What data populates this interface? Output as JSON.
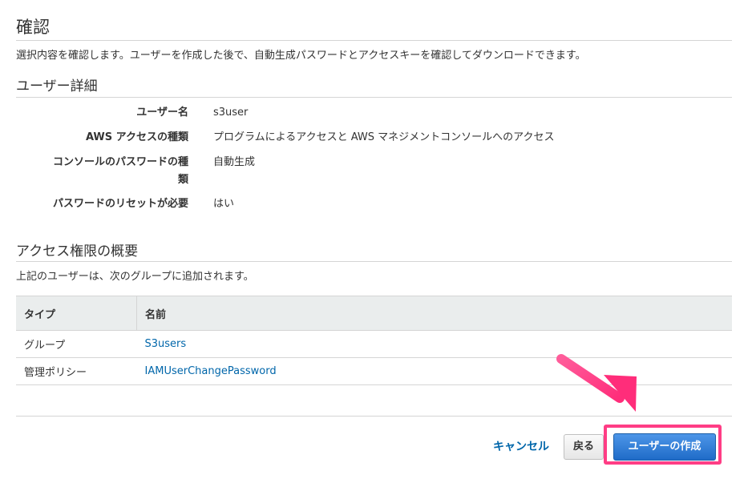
{
  "header": {
    "title": "確認",
    "description": "選択内容を確認します。ユーザーを作成した後で、自動生成パスワードとアクセスキーを確認してダウンロードできます。"
  },
  "user_details": {
    "heading": "ユーザー詳細",
    "rows": [
      {
        "label": "ユーザー名",
        "value": "s3user"
      },
      {
        "label": "AWS アクセスの種類",
        "value": "プログラムによるアクセスと AWS マネジメントコンソールへのアクセス"
      },
      {
        "label_line1": "コンソールのパスワードの種",
        "label_line2": "類",
        "value": "自動生成"
      },
      {
        "label": "パスワードのリセットが必要",
        "value": "はい"
      }
    ]
  },
  "permissions": {
    "heading": "アクセス権限の概要",
    "description": "上記のユーザーは、次のグループに追加されます。",
    "columns": [
      "タイプ",
      "名前"
    ],
    "rows": [
      {
        "type": "グループ",
        "name": "S3users"
      },
      {
        "type": "管理ポリシー",
        "name": "IAMUserChangePassword"
      }
    ]
  },
  "footer": {
    "cancel_label": "キャンセル",
    "back_label": "戻る",
    "create_label": "ユーザーの作成"
  },
  "colors": {
    "accent_link": "#0066aa",
    "primary_button": "#1f6bc8",
    "highlight": "#ff3d85"
  }
}
